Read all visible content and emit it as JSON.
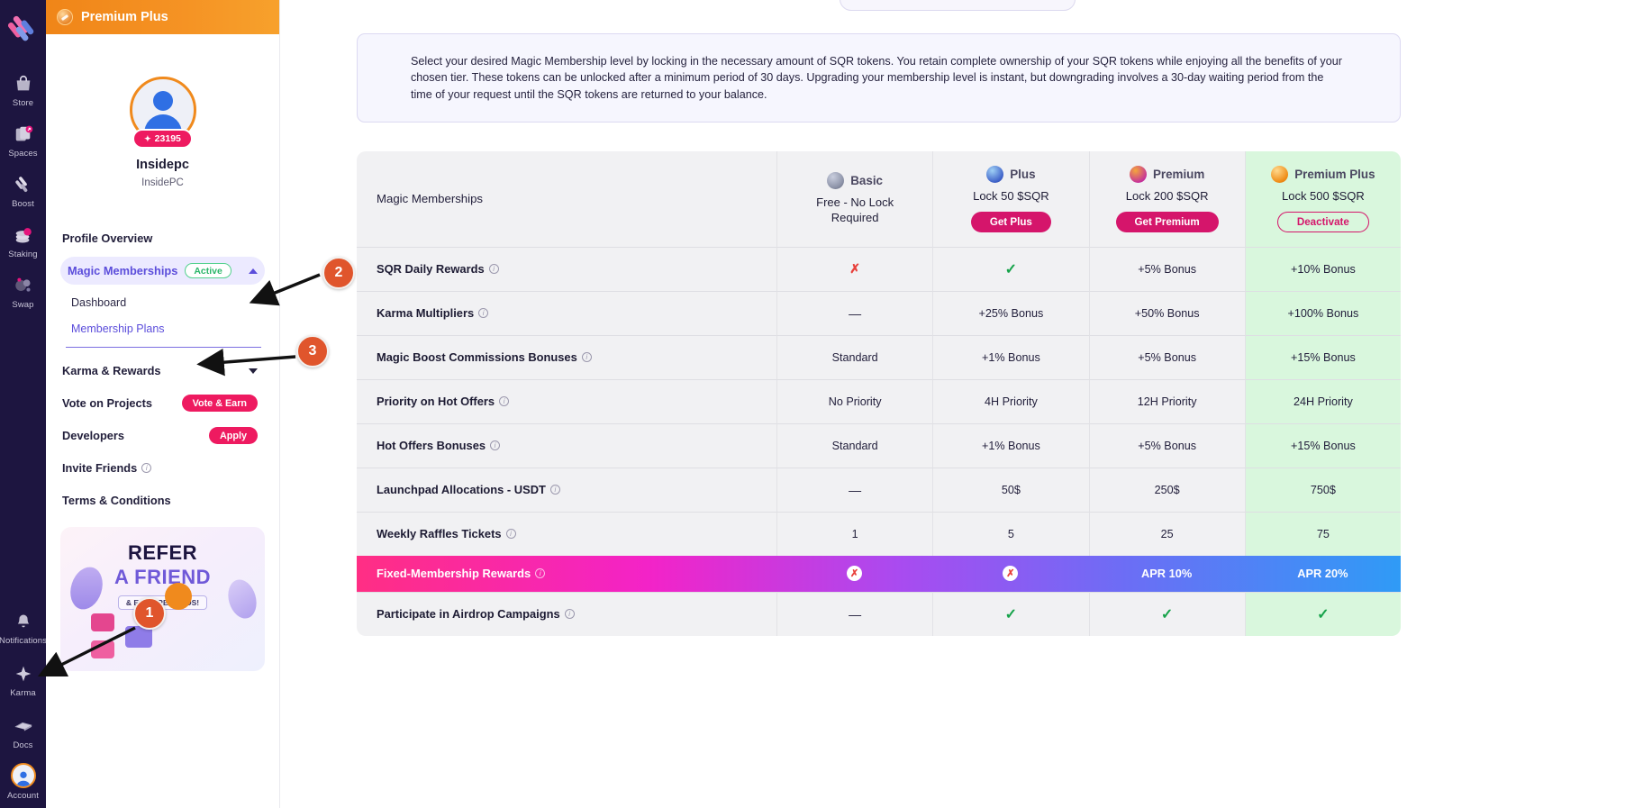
{
  "rail": {
    "logo_icon": "magic-square-logo-icon",
    "items": [
      {
        "label": "Store",
        "icon": "store-bag-icon"
      },
      {
        "label": "Spaces",
        "icon": "spaces-cards-icon"
      },
      {
        "label": "Boost",
        "icon": "boost-icon"
      },
      {
        "label": "Staking",
        "icon": "staking-coins-icon"
      },
      {
        "label": "Swap",
        "icon": "swap-circles-icon"
      }
    ],
    "bottom_items": [
      {
        "label": "Notifications",
        "icon": "bell-icon"
      },
      {
        "label": "Karma",
        "icon": "sparkle-icon"
      },
      {
        "label": "Docs",
        "icon": "docs-book-icon"
      },
      {
        "label": "Account",
        "icon": "account-avatar-icon"
      }
    ]
  },
  "sidebar": {
    "premium_banner": {
      "label": "Premium Plus",
      "icon": "premium-coin-icon"
    },
    "profile": {
      "karma_points": "23195",
      "karma_spark": "✦",
      "username": "Insidepc",
      "handle": "InsidePC"
    },
    "nav": {
      "profile_overview": "Profile Overview",
      "magic_memberships": "Magic Memberships",
      "magic_memberships_badge": "Active",
      "dashboard": "Dashboard",
      "membership_plans": "Membership Plans",
      "karma_rewards": "Karma & Rewards",
      "vote_on_projects": "Vote on Projects",
      "vote_button": "Vote & Earn",
      "developers": "Developers",
      "developers_button": "Apply",
      "invite_friends": "Invite Friends",
      "terms": "Terms & Conditions"
    },
    "refer_card": {
      "line1": "REFER",
      "line2": "A FRIEND",
      "line3": "& EARN REWARDS!"
    }
  },
  "main": {
    "notice": "Select your desired Magic Membership level by locking in the necessary amount of SQR tokens. You retain complete ownership of your SQR tokens while enjoying all the benefits of your chosen tier. These tokens can be unlocked after a minimum period of 30 days. Upgrading your membership level is instant, but downgrading involves a 30-day waiting period from the time of your request until the SQR tokens are returned to your balance."
  },
  "table": {
    "title": "Magic Memberships",
    "tiers": [
      {
        "name": "Basic",
        "lock": "Free - No Lock Required",
        "button": null,
        "icon": "basic-token-icon"
      },
      {
        "name": "Plus",
        "lock": "Lock 50 $SQR",
        "button": "Get Plus",
        "icon": "plus-token-icon"
      },
      {
        "name": "Premium",
        "lock": "Lock 200 $SQR",
        "button": "Get Premium",
        "icon": "premium-token-icon"
      },
      {
        "name": "Premium Plus",
        "lock": "Lock 500 $SQR",
        "button": "Deactivate",
        "icon": "premium-plus-token-icon"
      }
    ],
    "rows": [
      {
        "feature": "SQR Daily Rewards",
        "info": true,
        "values": [
          "✗",
          "✓",
          "+5% Bonus",
          "+10% Bonus"
        ],
        "kinds": [
          "cross",
          "check",
          "text",
          "text"
        ]
      },
      {
        "feature": "Karma Multipliers",
        "info": true,
        "values": [
          "—",
          "+25% Bonus",
          "+50% Bonus",
          "+100% Bonus"
        ],
        "kinds": [
          "dash",
          "text",
          "text",
          "text"
        ]
      },
      {
        "feature": "Magic Boost Commissions Bonuses",
        "info": true,
        "values": [
          "Standard",
          "+1% Bonus",
          "+5% Bonus",
          "+15% Bonus"
        ],
        "kinds": [
          "text",
          "text",
          "text",
          "text"
        ]
      },
      {
        "feature": "Priority on Hot Offers",
        "info": true,
        "values": [
          "No Priority",
          "4H Priority",
          "12H Priority",
          "24H Priority"
        ],
        "kinds": [
          "text",
          "text",
          "text",
          "text"
        ]
      },
      {
        "feature": "Hot Offers Bonuses",
        "info": true,
        "values": [
          "Standard",
          "+1% Bonus",
          "+5% Bonus",
          "+15% Bonus"
        ],
        "kinds": [
          "text",
          "text",
          "text",
          "text"
        ]
      },
      {
        "feature": "Launchpad Allocations - USDT",
        "info": true,
        "values": [
          "—",
          "50$",
          "250$",
          "750$"
        ],
        "kinds": [
          "dash",
          "text",
          "text",
          "text"
        ]
      },
      {
        "feature": "Weekly Raffles Tickets",
        "info": true,
        "values": [
          "1",
          "5",
          "25",
          "75"
        ],
        "kinds": [
          "text",
          "text",
          "text",
          "text"
        ]
      }
    ],
    "fixed_row": {
      "feature": "Fixed-Membership Rewards",
      "info": true,
      "values": [
        "✗",
        "✗",
        "APR 10%",
        "APR 20%"
      ],
      "kinds": [
        "xbadge",
        "xbadge",
        "text",
        "text"
      ]
    },
    "last_row": {
      "feature": "Participate in Airdrop Campaigns",
      "info": true,
      "values": [
        "—",
        "✓",
        "✓",
        "✓"
      ],
      "kinds": [
        "dash",
        "check",
        "check",
        "check"
      ]
    }
  },
  "annotations": [
    {
      "number": "1"
    },
    {
      "number": "2"
    },
    {
      "number": "3"
    }
  ],
  "colors": {
    "accent_orange": "#f08a1d",
    "accent_pink": "#ee1a60",
    "accent_purple": "#5b4ddb",
    "premium_plus_bg": "#d9f7dd",
    "rail_bg": "#1d1540"
  }
}
